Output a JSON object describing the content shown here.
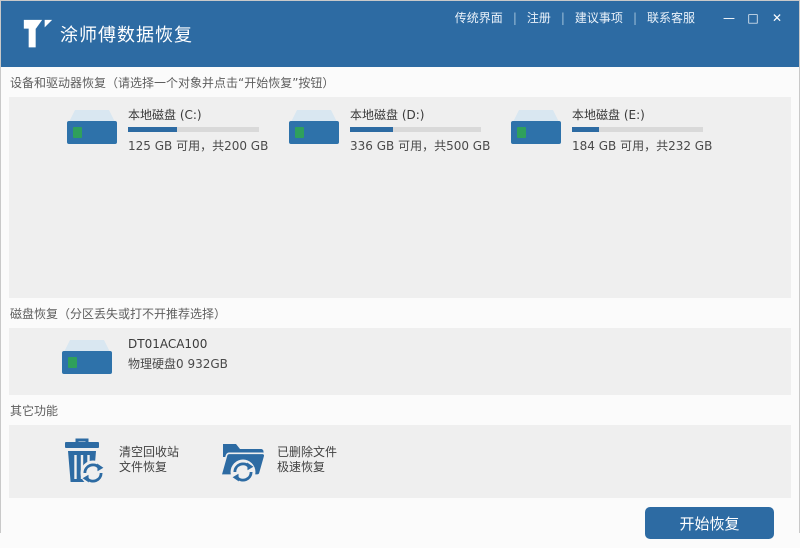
{
  "titlebar": {
    "title": "涂师傅数据恢复",
    "menu": [
      {
        "label": "传统界面"
      },
      {
        "label": "注册"
      },
      {
        "label": "建议事项"
      },
      {
        "label": "联系客服"
      }
    ],
    "controls": {
      "minimize": "—",
      "maximize": "□",
      "close": "✕"
    }
  },
  "sections": {
    "drives": {
      "header": "设备和驱动器恢复（请选择一个对象并点击“开始恢复”按钮）",
      "items": [
        {
          "name": "本地磁盘 (C:)",
          "detail": "125 GB 可用，共200 GB",
          "free_gb": 125,
          "total_gb": 200,
          "used_percent": 37.5
        },
        {
          "name": "本地磁盘 (D:)",
          "detail": "336 GB 可用，共500 GB",
          "free_gb": 336,
          "total_gb": 500,
          "used_percent": 32.8
        },
        {
          "name": "本地磁盘 (E:)",
          "detail": "184 GB 可用，共232 GB",
          "free_gb": 184,
          "total_gb": 232,
          "used_percent": 20.7
        }
      ]
    },
    "disks": {
      "header": "磁盘恢复（分区丢失或打不开推荐选择）",
      "items": [
        {
          "name": "DT01ACA100",
          "detail": "物理硬盘0 932GB"
        }
      ]
    },
    "other": {
      "header": "其它功能",
      "items": [
        {
          "line1": "清空回收站",
          "line2": "文件恢复",
          "icon": "recycle-bin-recover-icon"
        },
        {
          "line1": "已删除文件",
          "line2": "极速恢复",
          "icon": "deleted-files-recover-icon"
        }
      ]
    }
  },
  "footer": {
    "start_button": "开始恢复"
  },
  "colors": {
    "accent_blue": "#2d6ba3",
    "icon_blue": "#2e72aa",
    "panel_gray": "#efefef",
    "track_gray": "#d9d9d9",
    "led_green": "#2fa05c"
  }
}
